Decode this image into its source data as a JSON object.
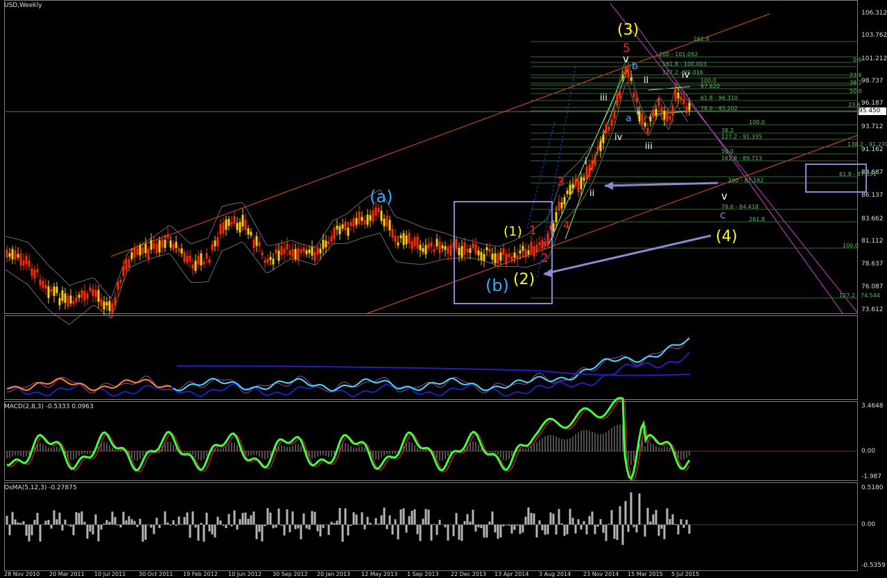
{
  "chart_data": {
    "type": "candlestick",
    "symbol_title": "USD,Weekly",
    "main": {
      "ylim": [
        73.612,
        106.312
      ],
      "yticks": [
        "106.312",
        "103.762",
        "101.212",
        "98.737",
        "96.187",
        "93.712",
        "91.162",
        "88.687",
        "86.137",
        "83.662",
        "81.112",
        "78.637",
        "76.087",
        "73.612"
      ],
      "current_price": "95.450",
      "wave_labels": [
        {
          "text": "(3)",
          "color": "#ffff00"
        },
        {
          "text": "5",
          "color": "#ff2020"
        },
        {
          "text": "v",
          "color": "#ffffff"
        },
        {
          "text": "b",
          "color": "#33aaff"
        },
        {
          "text": "ii",
          "color": "#ffffff"
        },
        {
          "text": "iv",
          "color": "#ffffff"
        },
        {
          "text": "iii",
          "color": "#ffffff"
        },
        {
          "text": "a",
          "color": "#33aaff"
        },
        {
          "text": "i",
          "color": "#ffffff"
        },
        {
          "text": "iv",
          "color": "#ffffff"
        },
        {
          "text": "iii",
          "color": "#ffffff"
        },
        {
          "text": "i",
          "color": "#ffffff"
        },
        {
          "text": "3",
          "color": "#ff2020"
        },
        {
          "text": "ii",
          "color": "#ffffff"
        },
        {
          "text": "4",
          "color": "#ff2020"
        },
        {
          "text": "(a)",
          "color": "#33aaff"
        },
        {
          "text": "(1)",
          "color": "#ffff00"
        },
        {
          "text": "1",
          "color": "#ff2020"
        },
        {
          "text": "2",
          "color": "#ff2020"
        },
        {
          "text": "(b)",
          "color": "#33aaff"
        },
        {
          "text": "(2)",
          "color": "#ffff00"
        },
        {
          "text": "v",
          "color": "#ffffff"
        },
        {
          "text": "c",
          "color": "#33aaff"
        },
        {
          "text": "(4)",
          "color": "#ffff00"
        }
      ],
      "fib_levels": [
        "261.8",
        "200 - 101.092",
        "0.0",
        "161.8 - 100.003",
        "127.2 - 99.016",
        "23.6",
        "100.0",
        "38.2",
        "97.620",
        "50.0",
        "61.8 - 96.310",
        "78.6 - 95.202",
        "23.6",
        "100.0",
        "38.2",
        "127.2 - 91.335",
        "138.2 - 91.270",
        "50.0",
        "161.8 - 89.713",
        "61.8 - 87.831",
        "200 - 87.192",
        "78.6 - 84.418",
        "261.8",
        "100.0",
        "127.2 - 74.544"
      ]
    },
    "pane_titles": [
      "MACD(2,8,3) -0.5333 0.0963",
      "OsMA(5,12,3) -0.27875"
    ],
    "macd_ticks": [
      "3.4648",
      "0.00",
      "-1.987"
    ],
    "osma_ticks": [
      "0.5180",
      "0.00",
      "-0.5359"
    ],
    "dates": [
      "28 Nov 2010",
      "20 Mar 2011",
      "10 Jul 2011",
      "30 Oct 2011",
      "19 Feb 2012",
      "10 Jun 2012",
      "30 Sep 2012",
      "20 Jan 2013",
      "12 May 2013",
      "1 Sep 2013",
      "22 Dec 2013",
      "13 Apr 2014",
      "3 Aug 2014",
      "23 Nov 2014",
      "15 Mar 2015",
      "5 Jul 2015"
    ]
  }
}
